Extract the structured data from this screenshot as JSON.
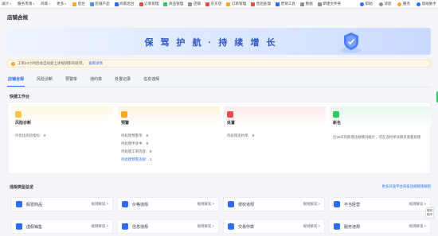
{
  "topbar": {
    "menus": [
      {
        "label": "设计"
      },
      {
        "label": "服务市场"
      },
      {
        "label": "商家"
      },
      {
        "label": "更多"
      }
    ],
    "bookmarks": [
      {
        "label": "后台",
        "color": "#f5a623"
      },
      {
        "label": "店铺产品",
        "color": "#4a90e2"
      },
      {
        "label": "商家后台",
        "color": "#2f6bff"
      },
      {
        "label": "订单管理",
        "color": "#e94b4b"
      },
      {
        "label": "商品管理",
        "color": "#34c759"
      },
      {
        "label": "店铺",
        "color": "#8e8e93"
      },
      {
        "label": "京东店",
        "color": "#e94b4b"
      },
      {
        "label": "订单管理",
        "color": "#f5a623"
      },
      {
        "label": "售后处理",
        "color": "#e94b4b"
      },
      {
        "label": "营销工具",
        "color": "#2f6bff"
      },
      {
        "label": "数据",
        "color": "#8e8e93"
      },
      {
        "label": "新建文件夹",
        "color": "#8e8e93"
      }
    ],
    "right_items": [
      {
        "label": "帮助",
        "color": "#2f6bff"
      },
      {
        "label": "消息",
        "color": "#8e8e93"
      },
      {
        "label": "服务",
        "color": "#f5a623"
      },
      {
        "label": "帮助助手",
        "color": "#2f6bff"
      }
    ]
  },
  "page": {
    "title": "店铺合规"
  },
  "banner": {
    "slogan": "保 驾 护 航 · 持 续 增 长"
  },
  "notice": {
    "text": "工单24小时后会自动受上述规则影响处罚。",
    "link": "查看详情"
  },
  "tabs": [
    {
      "label": "店铺合规",
      "active": true
    },
    {
      "label": "风险诊断"
    },
    {
      "label": "预警单"
    },
    {
      "label": "违约单"
    },
    {
      "label": "处置记录"
    },
    {
      "label": "信息违规"
    }
  ],
  "workbench": {
    "title": "快捷工作台",
    "cards": [
      {
        "title": "风险诊断",
        "icon": "diagnosis-icon",
        "color": "#f5c542",
        "head_bg": "#fff8e3",
        "rows": [
          {
            "label": "待优化风险指标:",
            "value": "0"
          }
        ]
      },
      {
        "title": "预警",
        "icon": "warning-icon",
        "color": "#f5a623",
        "head_bg": "#fff1de",
        "rows": [
          {
            "label": "待处理预警单:",
            "value": "0"
          },
          {
            "label": "待处理申诉中:",
            "value": "0"
          },
          {
            "label": "待处理工单内容:",
            "value": "0"
          },
          {
            "label": "待处理预警违规:",
            "value": "1",
            "link": true
          }
        ]
      },
      {
        "title": "处置",
        "icon": "disposal-icon",
        "color": "#e94b4b",
        "head_bg": "#fdeaea",
        "rows": [
          {
            "label": "待处理违约单:",
            "value": "0"
          }
        ]
      },
      {
        "title": "新名",
        "icon": "new-icon",
        "color": "#34c759",
        "head_bg": "#e6f7ec",
        "desc": "近30天内新增违规情况统计，可在违约单详情页查看处理"
      }
    ]
  },
  "violations": {
    "title": "违规类型总览",
    "link": "更多开放平台商家违规管理规则",
    "items": [
      {
        "label": "假冒商品",
        "action": "规则解读 >",
        "icon": "fake-goods-icon",
        "color": "#2f6bff"
      },
      {
        "label": "价格违规",
        "action": "规则解读 >",
        "icon": "price-icon",
        "color": "#2f6bff"
      },
      {
        "label": "侵权违规",
        "action": "规则解读 >",
        "icon": "infringement-icon",
        "color": "#2f6bff"
      },
      {
        "label": "不当经营",
        "action": "规则解读 >",
        "icon": "improper-icon",
        "color": "#2f6bff"
      },
      {
        "label": "虚假销售",
        "action": "规则解读 >",
        "icon": "false-sale-icon",
        "color": "#2f6bff"
      },
      {
        "label": "信息违规",
        "action": "规则解读 >",
        "icon": "info-icon",
        "color": "#2f6bff"
      },
      {
        "label": "交易作弊",
        "action": "规则解读 >",
        "icon": "trade-cheat-icon",
        "color": "#2f6bff"
      },
      {
        "label": "服务违规",
        "action": "规则解读 >",
        "icon": "service-icon",
        "color": "#2f6bff"
      }
    ]
  },
  "float": {
    "line1": "规则",
    "line2": "助手"
  }
}
